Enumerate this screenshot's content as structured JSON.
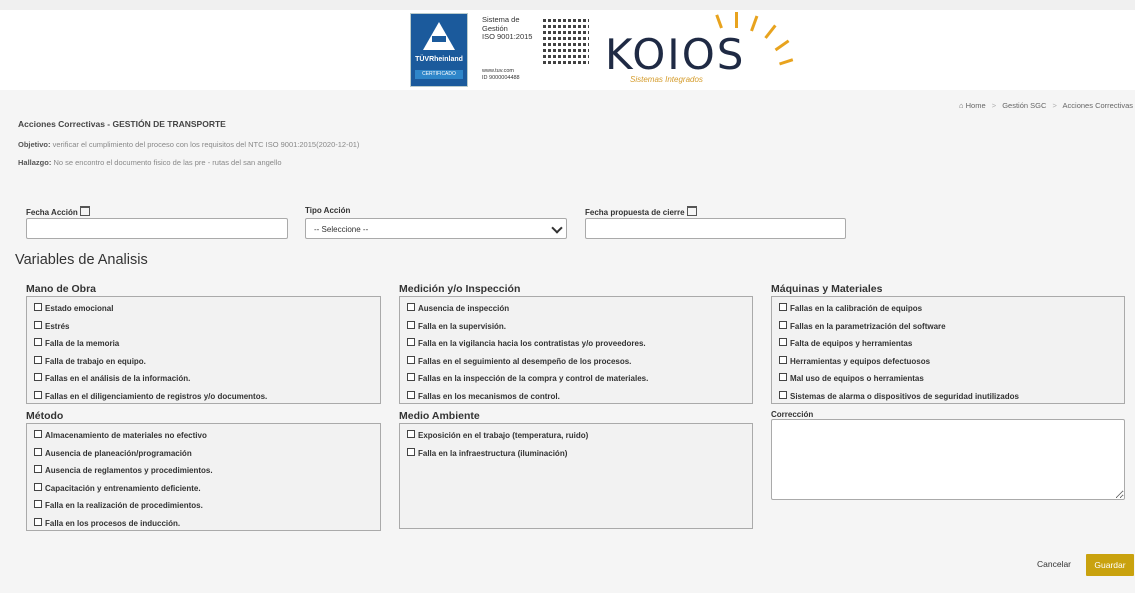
{
  "header": {
    "cert_lines": [
      "Sistema de",
      "Gestión",
      "ISO 9001:2015"
    ],
    "cert_url_lines": [
      "www.tuv.com",
      "ID 9000004488"
    ],
    "tuv_name": "TÜVRheinland",
    "tuv_cert": "CERTIFICADO",
    "brand": "KOIOS",
    "brand_sub": "Sistemas Integrados"
  },
  "breadcrumb": {
    "home": "Home",
    "level1": "Gestión SGC",
    "current": "Acciones Correctivas"
  },
  "page": {
    "title": "Acciones Correctivas - GESTIÓN DE TRANSPORTE",
    "objetivo_label": "Objetivo:",
    "objetivo_text": "verificar el cumplimiento del proceso con los requisitos del NTC ISO 9001:2015(2020-12-01)",
    "hallazgo_label": "Hallazgo:",
    "hallazgo_text": "No se encontro el documento fisico de las pre - rutas del san angello"
  },
  "form": {
    "fecha_accion_label": "Fecha Acción",
    "fecha_accion_value": "",
    "tipo_accion_label": "Tipo Acción",
    "tipo_accion_selected": "-- Seleccione --",
    "fecha_cierre_label": "Fecha propuesta de cierre",
    "fecha_cierre_value": ""
  },
  "analysis": {
    "title": "Variables de Analisis",
    "mano_de_obra": {
      "title": "Mano de Obra",
      "items": [
        "Estado emocional",
        "Estrés",
        "Falla de la memoria",
        "Falla de trabajo en equipo.",
        "Fallas en el análisis de la información.",
        "Fallas en el diligenciamiento de registros y/o documentos."
      ]
    },
    "medicion": {
      "title": "Medición y/o Inspección",
      "items": [
        "Ausencia de inspección",
        "Falla en la supervisión.",
        "Falla en la vigilancia hacia los contratistas y/o proveedores.",
        "Fallas en el seguimiento al desempeño de los procesos.",
        "Fallas en la inspección de la compra y control de materiales.",
        "Fallas en los mecanismos de control."
      ]
    },
    "maquinas": {
      "title": "Máquinas y Materiales",
      "items": [
        "Fallas en la calibración de equipos",
        "Fallas en la parametrización del software",
        "Falta de equipos y herramientas",
        "Herramientas y equipos defectuosos",
        "Mal uso de equipos o herramientas",
        "Sistemas de alarma o dispositivos de seguridad inutilizados"
      ]
    },
    "metodo": {
      "title": "Método",
      "items": [
        "Almacenamiento de materiales no efectivo",
        "Ausencia de planeación/programación",
        "Ausencia de reglamentos y procedimientos.",
        "Capacitación y entrenamiento deficiente.",
        "Falla en la realización de procedimientos.",
        "Falla en los procesos de inducción."
      ]
    },
    "medio_ambiente": {
      "title": "Medio Ambiente",
      "items": [
        "Exposición en el trabajo (temperatura, ruido)",
        "Falla en la infraestructura (iluminación)"
      ]
    },
    "correccion_label": "Corrección",
    "correccion_value": ""
  },
  "actions": {
    "cancel": "Cancelar",
    "save": "Guardar"
  },
  "colors": {
    "accent": "#c9a20e",
    "tuv_blue": "#1b5a9c",
    "brand_dark": "#1f2a44"
  }
}
